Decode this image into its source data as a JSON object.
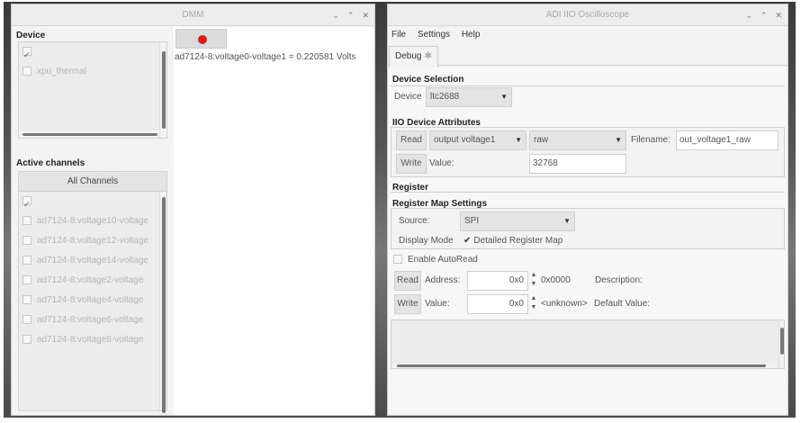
{
  "dmm": {
    "title": "DMM",
    "controls": [
      "⌄",
      "⌃",
      "✕"
    ],
    "device": {
      "section_title": "Device",
      "items": [
        {
          "label": "",
          "checked": true
        },
        {
          "label": "xpu_thermal",
          "checked": false
        }
      ]
    },
    "active_channels": {
      "section_title": "Active channels",
      "all_button": "All Channels",
      "items": [
        {
          "label": "",
          "checked": true
        },
        {
          "label": "ad7124-8:voltage10-voltage",
          "checked": false
        },
        {
          "label": "ad7124-8:voltage12-voltage",
          "checked": false
        },
        {
          "label": "ad7124-8:voltage14-voltage",
          "checked": false
        },
        {
          "label": "ad7124-8:voltage2-voltage",
          "checked": false
        },
        {
          "label": "ad7124-8:voltage4-voltage",
          "checked": false
        },
        {
          "label": "ad7124-8:voltage6-voltage",
          "checked": false
        },
        {
          "label": "ad7124-8:voltage8-voltage",
          "checked": false
        }
      ]
    },
    "reading": "ad7124-8:voltage0-voltage1 = 0.220581 Volts",
    "colors": {
      "record_dot": "#d31d1d"
    }
  },
  "osc": {
    "title": "ADI IIO Oscilloscope",
    "controls": [
      "⌄",
      "⌃",
      "✕"
    ],
    "menu": [
      "File",
      "Settings",
      "Help"
    ],
    "tab": {
      "label": "Debug",
      "close_icon": "close-icon"
    },
    "device_selection": {
      "title": "Device Selection",
      "device_label": "Device",
      "device_value": "ltc2688"
    },
    "iio_attributes": {
      "title": "IIO Device Attributes",
      "read_button": "Read",
      "write_button": "Write",
      "channel_value": "output voltage1",
      "attr_value": "raw",
      "filename_label": "Filename:",
      "filename_value": "out_voltage1_raw",
      "value_label": "Value:",
      "value_value": "32768"
    },
    "register": {
      "title": "Register",
      "map_settings_title": "Register Map Settings",
      "source_label": "Source:",
      "source_value": "SPI",
      "display_mode_label": "Display Mode",
      "detailed_label": "Detailed Register Map",
      "detailed_checked": true,
      "autoread_label": "Enable AutoRead",
      "autoread_checked": false,
      "read_button": "Read",
      "write_button": "Write",
      "address_label": "Address:",
      "address_value": "0x0",
      "address_hex": "0x0000",
      "description_label": "Description:",
      "value_label": "Value:",
      "value_value": "0x0",
      "value_unknown": "<unknown>",
      "default_label": "Default Value:"
    }
  }
}
